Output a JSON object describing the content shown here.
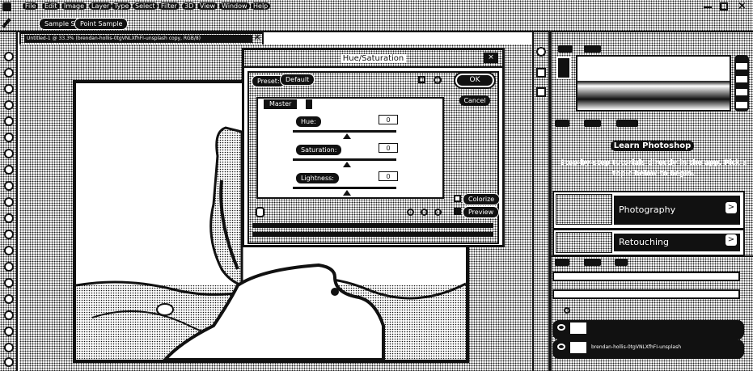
{
  "menubar": {
    "items": [
      "File",
      "Edit",
      "Image",
      "Layer",
      "Type",
      "Select",
      "Filter",
      "3D",
      "View",
      "Window",
      "Help"
    ]
  },
  "options": {
    "sample_size_label": "Sample Size",
    "sample_value": "Point Sample"
  },
  "document": {
    "tab_title": "Untitled-1 @ 33.3% (brendan-hollis-0tgVNLXfhFI-unsplash copy, RGB/8)",
    "close": "×"
  },
  "dialog": {
    "title": "Hue/Saturation",
    "preset_label": "Preset:",
    "preset_value": "Default",
    "ok_label": "OK",
    "cancel_label": "Cancel",
    "channel_value": "Master",
    "hue_label": "Hue:",
    "hue_value": "0",
    "saturation_label": "Saturation:",
    "saturation_value": "0",
    "lightness_label": "Lightness:",
    "lightness_value": "0",
    "colorize_label": "Colorize",
    "preview_label": "Preview"
  },
  "learn": {
    "title": "Learn Photoshop",
    "desc": "Step-by-step tutorials directly in the app. Pick a topic below to begin.",
    "cards": [
      {
        "label": "Photography"
      },
      {
        "label": "Retouching"
      }
    ]
  },
  "layers": {
    "rows": [
      {
        "name": ""
      },
      {
        "name": "brendan-hollis-0tgVNLXfhFI-unsplash"
      }
    ]
  }
}
